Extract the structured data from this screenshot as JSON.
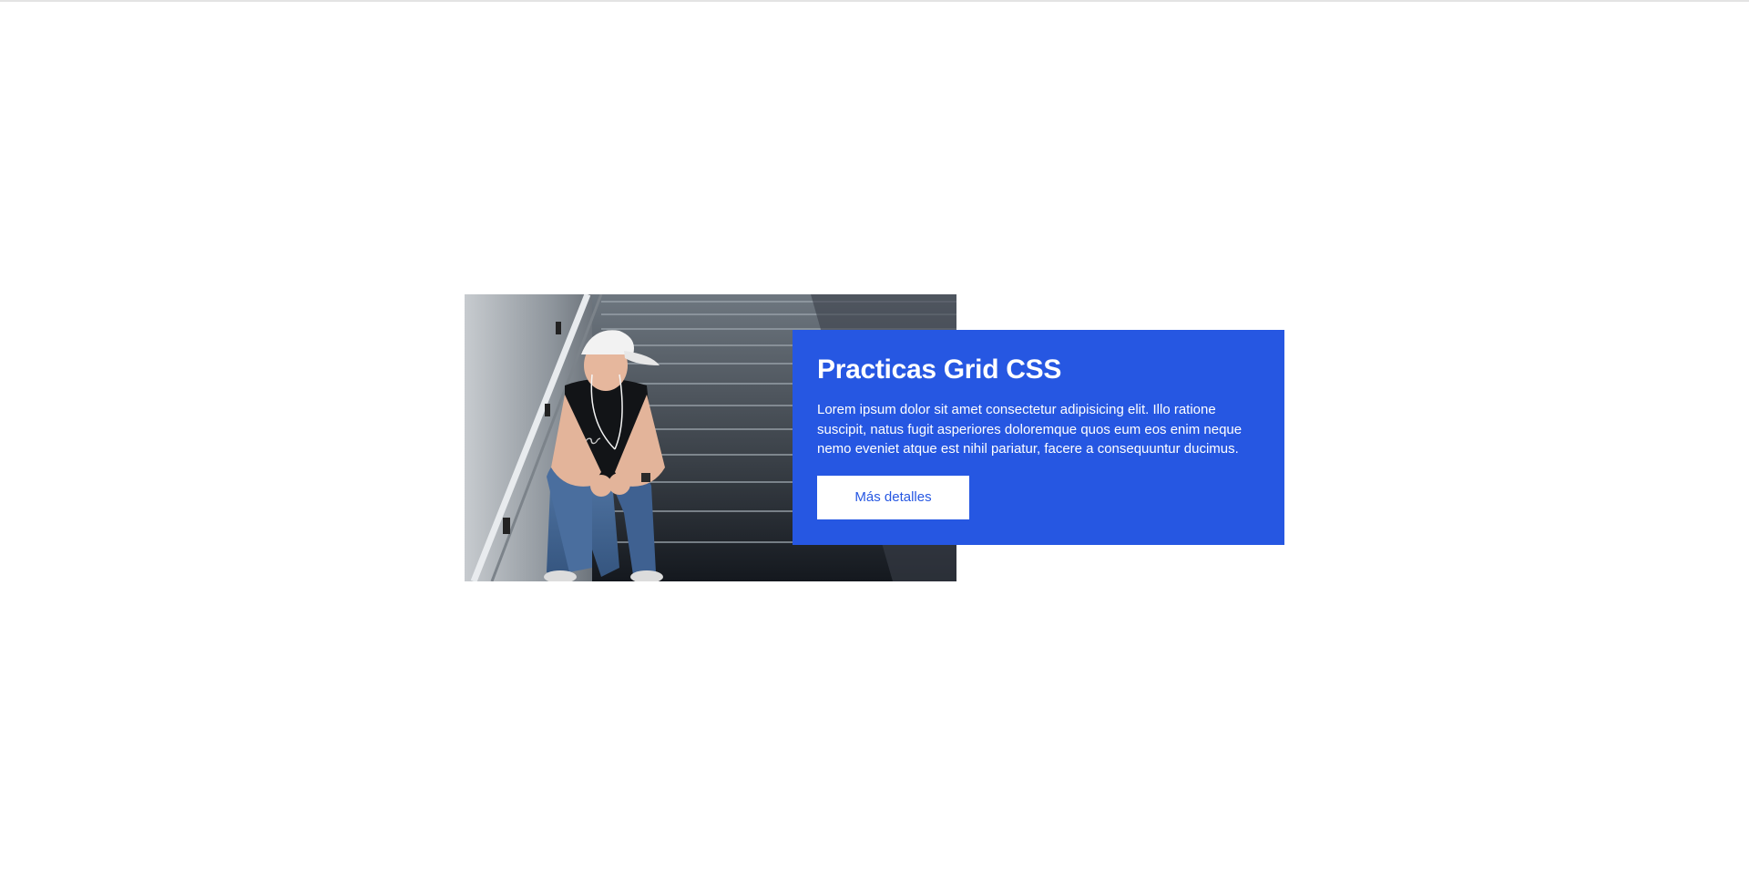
{
  "card": {
    "title": "Practicas Grid CSS",
    "description": "Lorem ipsum dolor sit amet consectetur adipisicing elit. Illo ratione suscipit, natus fugit asperiores doloremque quos eum eos enim neque nemo eveniet atque est nihil pariatur, facere a consequuntur ducimus.",
    "button_label": "Más detalles",
    "image_subject": "person-sitting-on-stairs-image"
  },
  "colors": {
    "panel_background": "#2657e2",
    "panel_text": "#ffffff",
    "button_background": "#ffffff",
    "button_text": "#2657e2"
  }
}
